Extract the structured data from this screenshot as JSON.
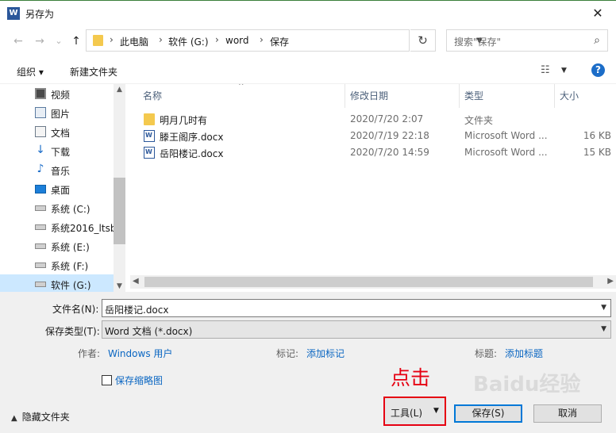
{
  "window": {
    "title": "另存为",
    "close_glyph": "✕"
  },
  "nav": {
    "back_glyph": "←",
    "forward_glyph": "→",
    "recent_glyph": "⌄",
    "up_glyph": "↑",
    "breadcrumbs": [
      "此电脑",
      "软件 (G:)",
      "word",
      "保存"
    ],
    "separator": "›",
    "search_placeholder": "搜索\"保存\""
  },
  "toolbar": {
    "organize_label": "组织 ▾",
    "new_folder_label": "新建文件夹",
    "help_glyph": "?"
  },
  "sidebar": {
    "items": [
      {
        "label": "视频",
        "icon": "video-icon"
      },
      {
        "label": "图片",
        "icon": "picture-icon"
      },
      {
        "label": "文档",
        "icon": "document-icon"
      },
      {
        "label": "下载",
        "icon": "download-icon"
      },
      {
        "label": "音乐",
        "icon": "music-icon"
      },
      {
        "label": "桌面",
        "icon": "desktop-icon"
      },
      {
        "label": "系统 (C:)",
        "icon": "drive-icon"
      },
      {
        "label": "系统2016_ltsb",
        "icon": "drive-icon"
      },
      {
        "label": "系统 (E:)",
        "icon": "drive-icon"
      },
      {
        "label": "系统 (F:)",
        "icon": "drive-icon"
      },
      {
        "label": "软件 (G:)",
        "icon": "drive-icon",
        "selected": true
      }
    ]
  },
  "file_list": {
    "columns": [
      "名称",
      "修改日期",
      "类型",
      "大小"
    ],
    "rows": [
      {
        "name": "明月几时有",
        "date": "2020/7/20 2:07",
        "type": "文件夹",
        "size": "",
        "kind": "folder"
      },
      {
        "name": "滕王阁序.docx",
        "date": "2020/7/19 22:18",
        "type": "Microsoft Word ...",
        "size": "16 KB",
        "kind": "word"
      },
      {
        "name": "岳阳楼记.docx",
        "date": "2020/7/20 14:59",
        "type": "Microsoft Word ...",
        "size": "15 KB",
        "kind": "word"
      }
    ]
  },
  "form": {
    "filename_label": "文件名(N):",
    "filename_value": "岳阳楼记.docx",
    "filetype_label": "保存类型(T):",
    "filetype_value": "Word 文档 (*.docx)",
    "author_label": "作者:",
    "author_value": "Windows 用户",
    "tags_label": "标记:",
    "tags_value": "添加标记",
    "title_label": "标题:",
    "title_value": "添加标题",
    "thumbnail_label": "保存缩略图"
  },
  "footer": {
    "hide_folders_label": "隐藏文件夹",
    "tools_label": "工具(L)",
    "save_label": "保存(S)",
    "cancel_label": "取消"
  },
  "annotation": {
    "text": "点击",
    "color": "#e60012"
  },
  "watermark": {
    "text": "Baidu经验"
  },
  "colors": {
    "selection": "#cce8ff",
    "link": "#0a66c2",
    "primary_border": "#0078d7",
    "highlight_box": "#e60012"
  }
}
